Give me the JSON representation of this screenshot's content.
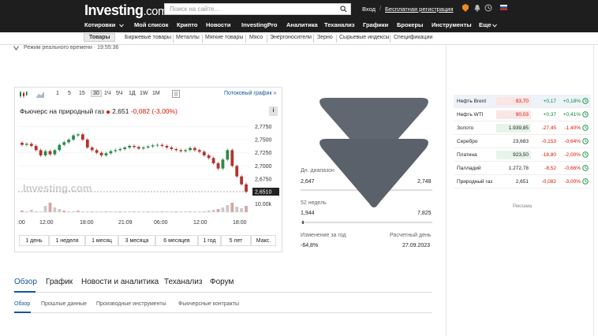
{
  "header": {
    "logo_main": "Investing",
    "logo_suffix": ".com",
    "search_placeholder": "Поиск на сайте...",
    "login": "Вход",
    "separator": "/",
    "register": "Бесплатная регистрация"
  },
  "nav": [
    "Котировки",
    "Мой список",
    "Крипто",
    "Новости",
    "InvestingPro",
    "Аналитика",
    "Теханализ",
    "Графики",
    "Брокеры",
    "Инструменты",
    "Еще"
  ],
  "subnav": [
    "Товары",
    "Биржевые товары",
    "Металлы",
    "Мягкие товары",
    "Мясо",
    "Энергоносители",
    "Зерно",
    "Сырьевые индексы",
    "Спецификации"
  ],
  "realtime": "Режим реального времени · 19:55:36",
  "chart_panel": {
    "toolbar": [
      "1",
      "5",
      "15",
      "30",
      "1Ч",
      "5Ч",
      "1Д",
      "1W",
      "1M"
    ],
    "active_interval": "30",
    "stream_link": "Потоковый график »",
    "title": "Фьючерс на природный газ",
    "price": "2,651",
    "change": "-0,082",
    "change_pct": "(-3,00%)",
    "info": "i",
    "periods": [
      "1 день",
      "1 неделя",
      "1 месяц",
      "3 месяца",
      "6 месяцев",
      "1 год",
      "5 лет",
      "Макс."
    ]
  },
  "chart_data": {
    "type": "candlestick",
    "x_ticks": [
      ":00",
      "12:00",
      "18:00",
      "21:09",
      "06:00",
      "12:00",
      "18:00"
    ],
    "y_ticks": [
      "2,7750",
      "2,7500",
      "2,7250",
      "2,7000",
      "2,6750"
    ],
    "ylim": [
      2.645,
      2.78
    ],
    "current_price_label": "2,6510",
    "current_price": 2.651,
    "volume_label": "10.00k",
    "watermark": "Investing",
    "watermark_suffix": ".com",
    "closes": [
      2.74,
      2.742,
      2.738,
      2.73,
      2.72,
      2.728,
      2.722,
      2.73,
      2.74,
      2.745,
      2.75,
      2.758,
      2.76,
      2.75,
      2.735,
      2.73,
      2.725,
      2.72,
      2.724,
      2.728,
      2.73,
      2.732,
      2.735,
      2.738,
      2.736,
      2.733,
      2.735,
      2.737,
      2.739,
      2.74,
      2.738,
      2.735,
      2.732,
      2.73,
      2.728,
      2.73,
      2.734,
      2.73,
      2.727,
      2.72,
      2.715,
      2.705,
      2.695,
      2.712,
      2.73,
      2.7,
      2.68,
      2.665,
      2.651
    ]
  },
  "stats": {
    "day_range_label": "Дн. диапазон",
    "day_low": "2,647",
    "day_high": "2,748",
    "week52_label": "52 недель",
    "week52_low": "1,944",
    "week52_high": "7,825",
    "year_change_label": "Изменение за год",
    "year_change": "-64,8%",
    "settlement_label": "Расчетный день",
    "settlement_date": "27.09.2023"
  },
  "main_tabs": [
    "Обзор",
    "График",
    "Новости и аналитика",
    "Теханализ",
    "Форум"
  ],
  "sub_tabs": [
    "Обзор",
    "Прошлые данные",
    "Производные инструменты",
    "Фьючерсные контракты"
  ],
  "side_table": [
    {
      "name": "Нефть Brent",
      "last": "93,70",
      "chg": "+0,17",
      "pct": "+0,18%",
      "dir": "down"
    },
    {
      "name": "Нефть WTI",
      "last": "90,03",
      "chg": "+0,37",
      "pct": "+0,41%",
      "dir": "down"
    },
    {
      "name": "Золото",
      "last": "1.939,85",
      "chg": "-27,45",
      "pct": "-1,40%",
      "dir": "up"
    },
    {
      "name": "Серебро",
      "last": "23,683",
      "chg": "-0,153",
      "pct": "-0,64%",
      "dir": "none"
    },
    {
      "name": "Платина",
      "last": "923,50",
      "chg": "-18,80",
      "pct": "-2,00%",
      "dir": "up"
    },
    {
      "name": "Палладий",
      "last": "1.272,78",
      "chg": "-8,52",
      "pct": "-0,66%",
      "dir": "none"
    },
    {
      "name": "Природный газ",
      "last": "2,651",
      "chg": "-0,082",
      "pct": "-3,00%",
      "dir": "none"
    }
  ],
  "ad_label": "Реклама",
  "colors": {
    "accent": "#1256a0",
    "negative": "#d91400",
    "positive": "#0a8a3a",
    "topbar": "#1e1e1e"
  }
}
